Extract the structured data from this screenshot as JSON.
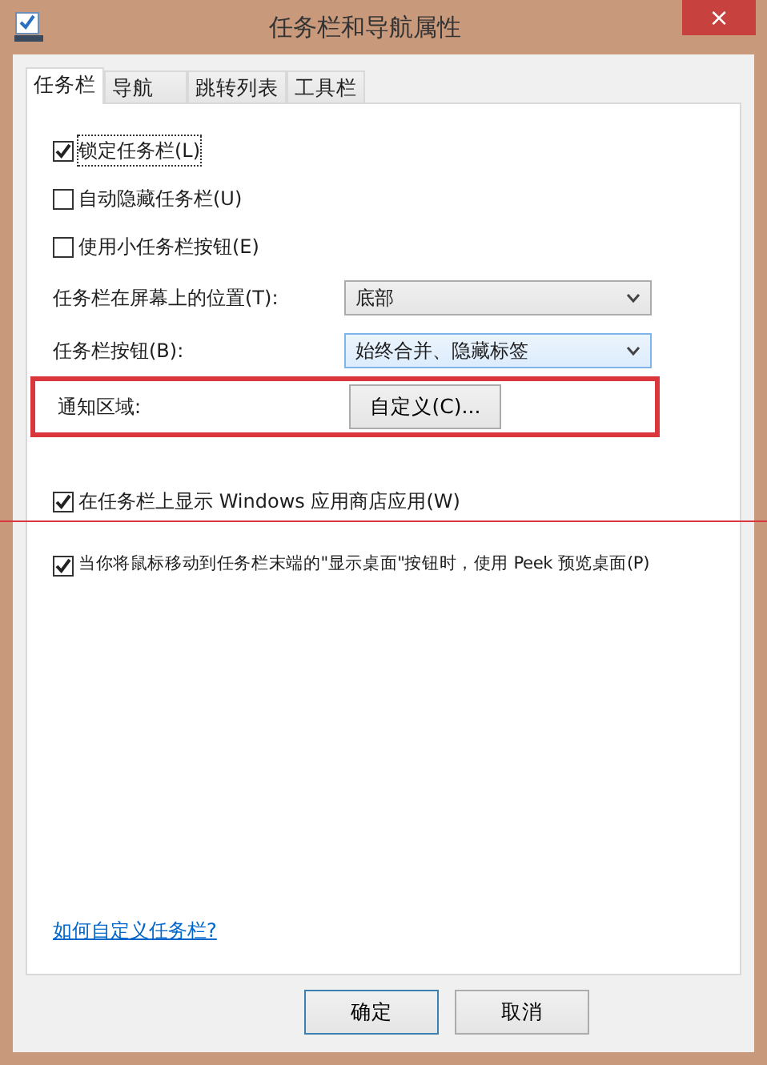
{
  "window": {
    "title": "任务栏和导航属性",
    "close": "×"
  },
  "tabs": [
    {
      "label": "任务栏",
      "selected": true
    },
    {
      "label": "导航",
      "selected": false
    },
    {
      "label": "跳转列表",
      "selected": false
    },
    {
      "label": "工具栏",
      "selected": false
    }
  ],
  "top_options": [
    {
      "label": "锁定任务栏(L)",
      "checked": true,
      "focused": true
    },
    {
      "label": "自动隐藏任务栏(U)",
      "checked": false,
      "focused": false
    },
    {
      "label": "使用小任务栏按钮(E)",
      "checked": false,
      "focused": false
    }
  ],
  "settings": [
    {
      "label": "任务栏在屏幕上的位置(T):",
      "value": "底部",
      "hover": false
    },
    {
      "label": "任务栏按钮(B):",
      "value": "始终合并、隐藏标签",
      "hover": true
    }
  ],
  "notification_area": {
    "label": "通知区域:",
    "button": "自定义(C)...",
    "highlighted": true
  },
  "bottom_options": [
    {
      "label": "在任务栏上显示 Windows 应用商店应用(W)",
      "checked": true
    },
    {
      "label": "当你将鼠标移动到任务栏末端的\"显示桌面\"按钮时，使用 Peek 预览桌面(P)",
      "checked": true
    }
  ],
  "annotation_line": true,
  "help_link": "如何自定义任务栏?",
  "buttons": [
    {
      "label": "确定",
      "default": true
    },
    {
      "label": "取消",
      "default": false
    }
  ]
}
